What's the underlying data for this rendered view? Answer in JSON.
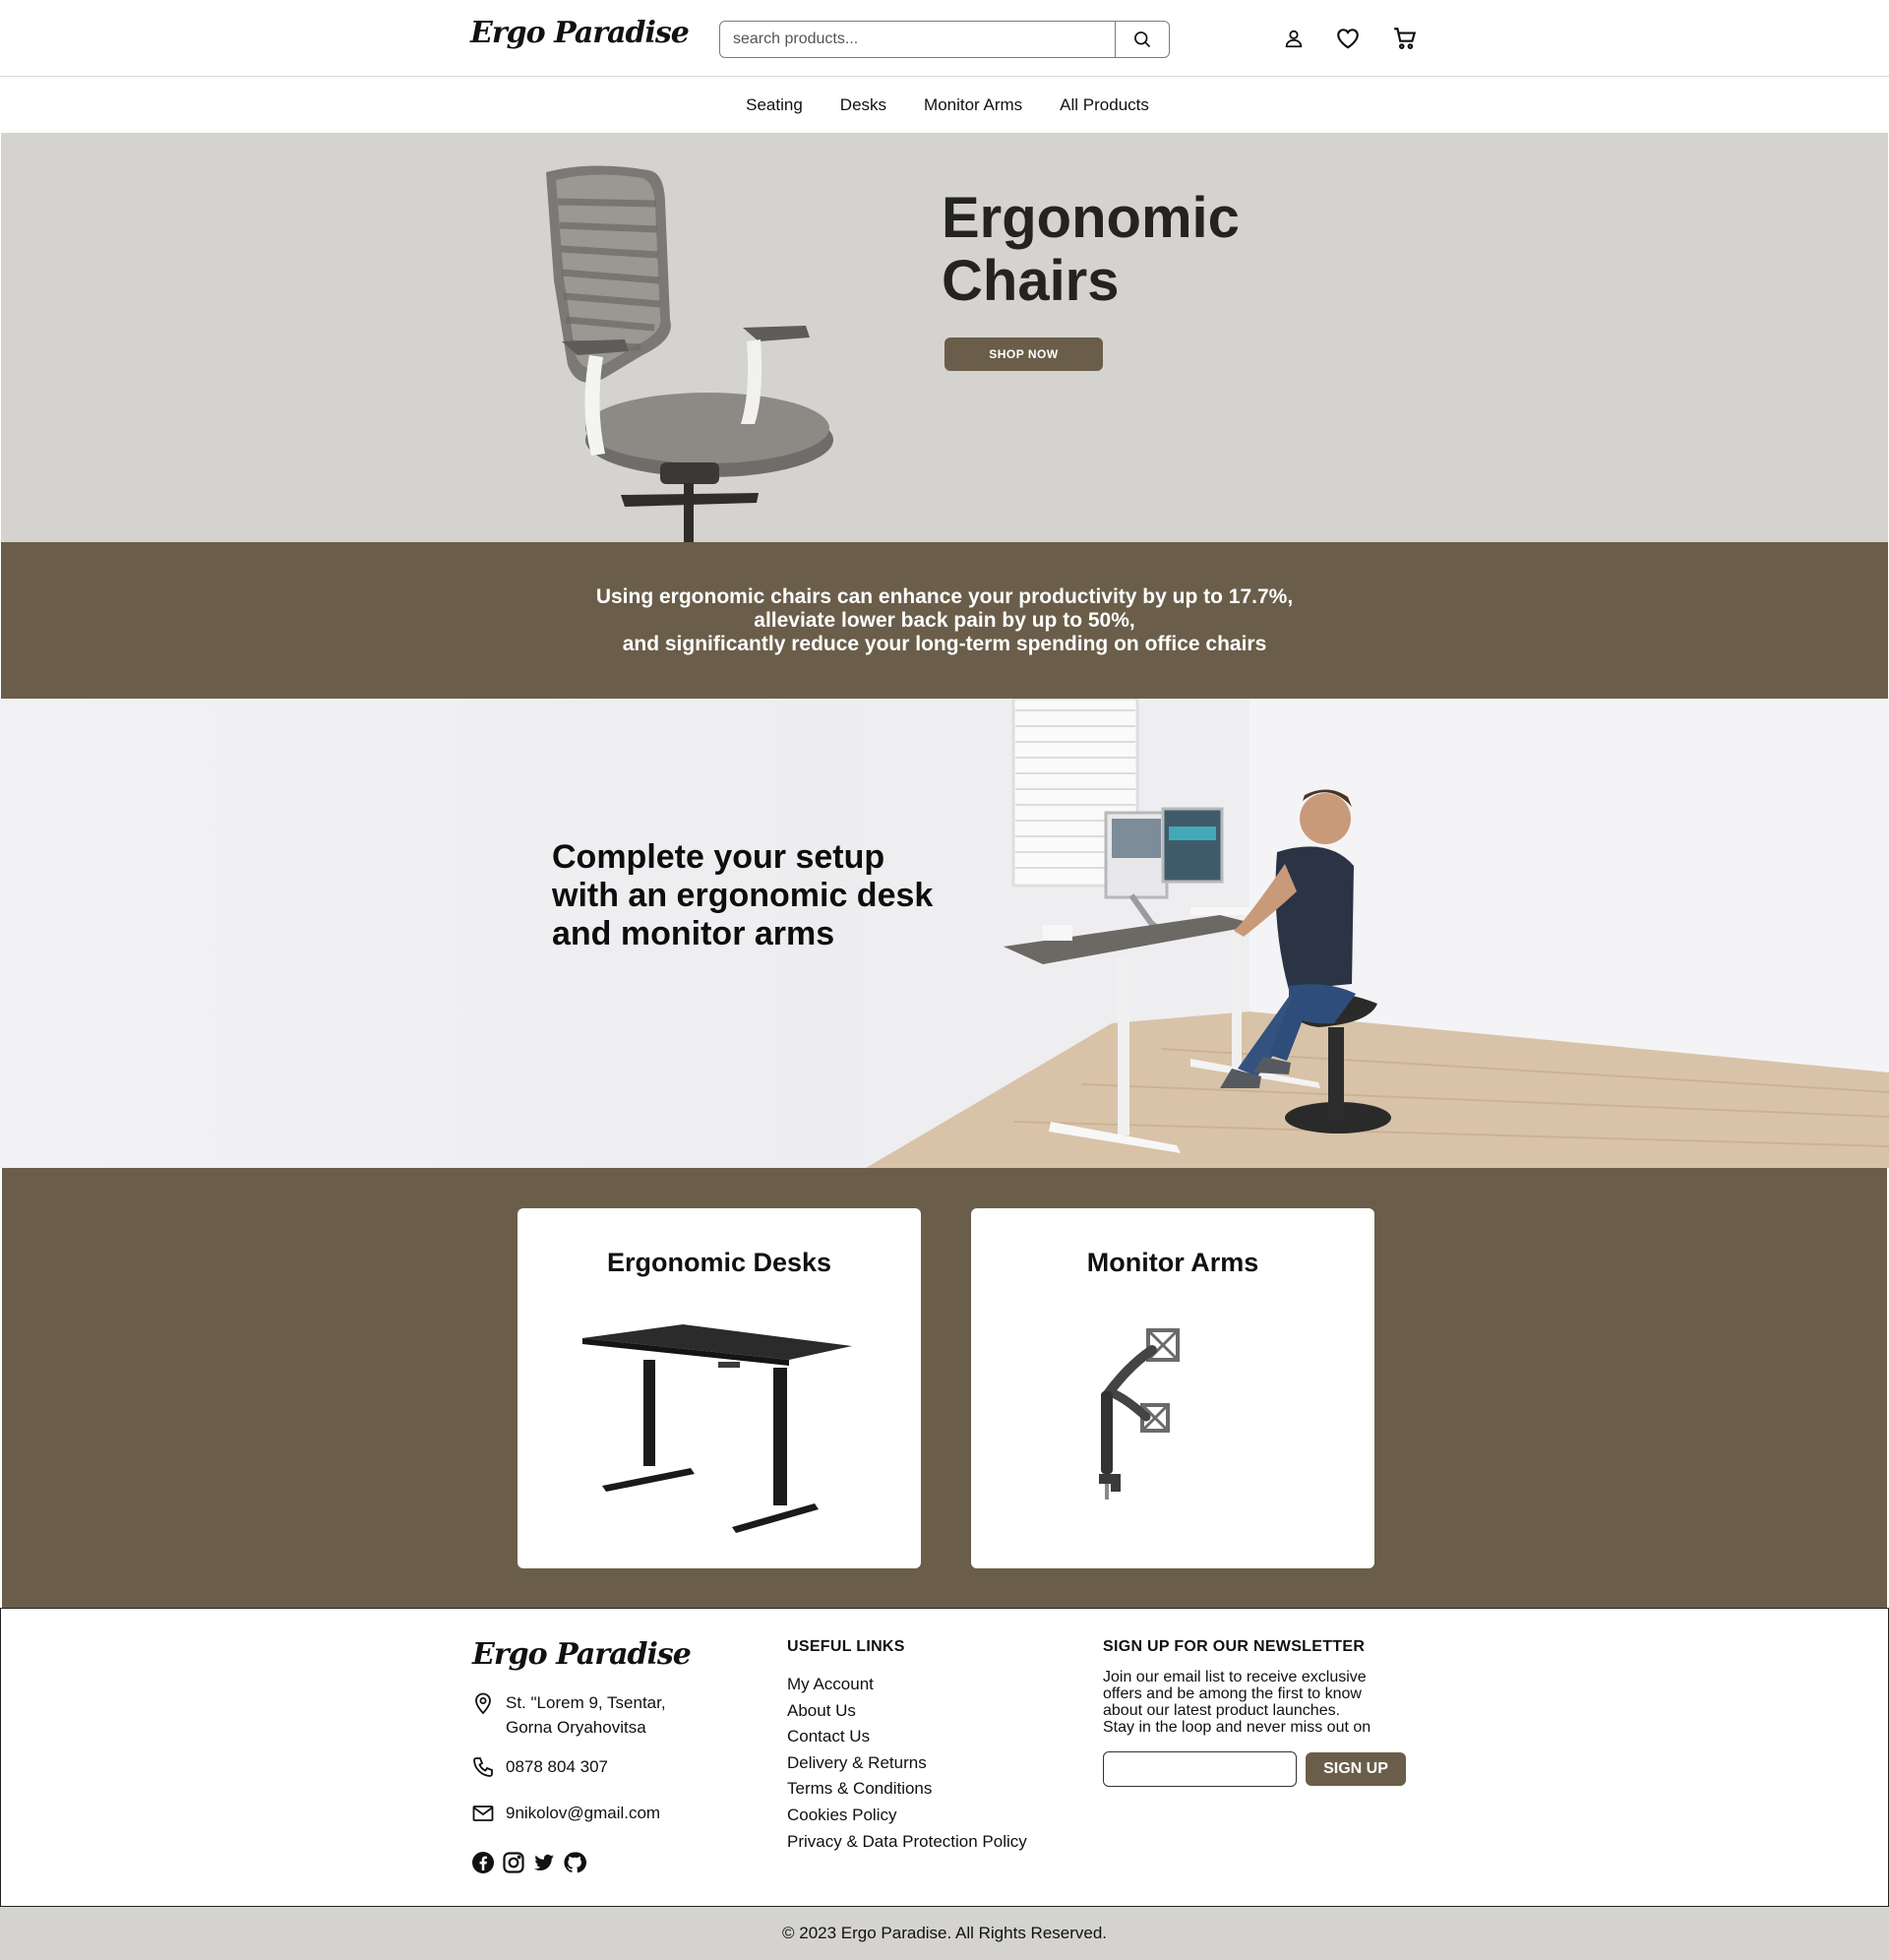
{
  "brand": {
    "logo_text": "Ergo Paradise",
    "accent": "#6a5e4a",
    "hero_bg": "#d4d3cf"
  },
  "header": {
    "search_placeholder": "search products...",
    "icons": [
      "search-icon",
      "user-icon",
      "heart-icon",
      "cart-icon"
    ]
  },
  "nav": {
    "items": [
      "Seating",
      "Desks",
      "Monitor Arms",
      "All Products"
    ]
  },
  "hero": {
    "title_line1": "Ergonomic",
    "title_line2": "Chairs",
    "cta": "SHOP NOW"
  },
  "stats": {
    "line1": "Using ergonomic chairs can enhance your productivity by up to 17.7%,",
    "line2": "alleviate lower back pain by up to 50%,",
    "line3": "and significantly reduce your long-term spending on office chairs"
  },
  "setup": {
    "line1": "Complete your setup",
    "line2": "with an ergonomic desk",
    "line3": "and monitor arms"
  },
  "categories": [
    {
      "title": "Ergonomic Desks"
    },
    {
      "title": "Monitor Arms"
    }
  ],
  "footer": {
    "logo_text": "Ergo Paradise",
    "address_line1": "St. \"Lorem 9, Tsentar,",
    "address_line2": "Gorna Oryahovitsa",
    "phone": "0878 804 307",
    "email": "9nikolov@gmail.com",
    "social": [
      "facebook-icon",
      "instagram-icon",
      "twitter-icon",
      "github-icon"
    ],
    "links_heading": "USEFUL LINKS",
    "links": [
      "My Account",
      "About Us",
      "Contact Us",
      "Delivery & Returns",
      "Terms & Conditions",
      "Cookies Policy",
      "Privacy & Data Protection Policy"
    ],
    "newsletter_heading": "SIGN UP FOR OUR NEWSLETTER",
    "newsletter_line1": "Join our email list to receive exclusive",
    "newsletter_line2": "offers and be among the first to know",
    "newsletter_line3": "about our latest product launches.",
    "newsletter_line4": "Stay in the loop and never miss out on",
    "newsletter_button": "SIGN UP"
  },
  "copyright": "© 2023 Ergo Paradise. All Rights Reserved."
}
